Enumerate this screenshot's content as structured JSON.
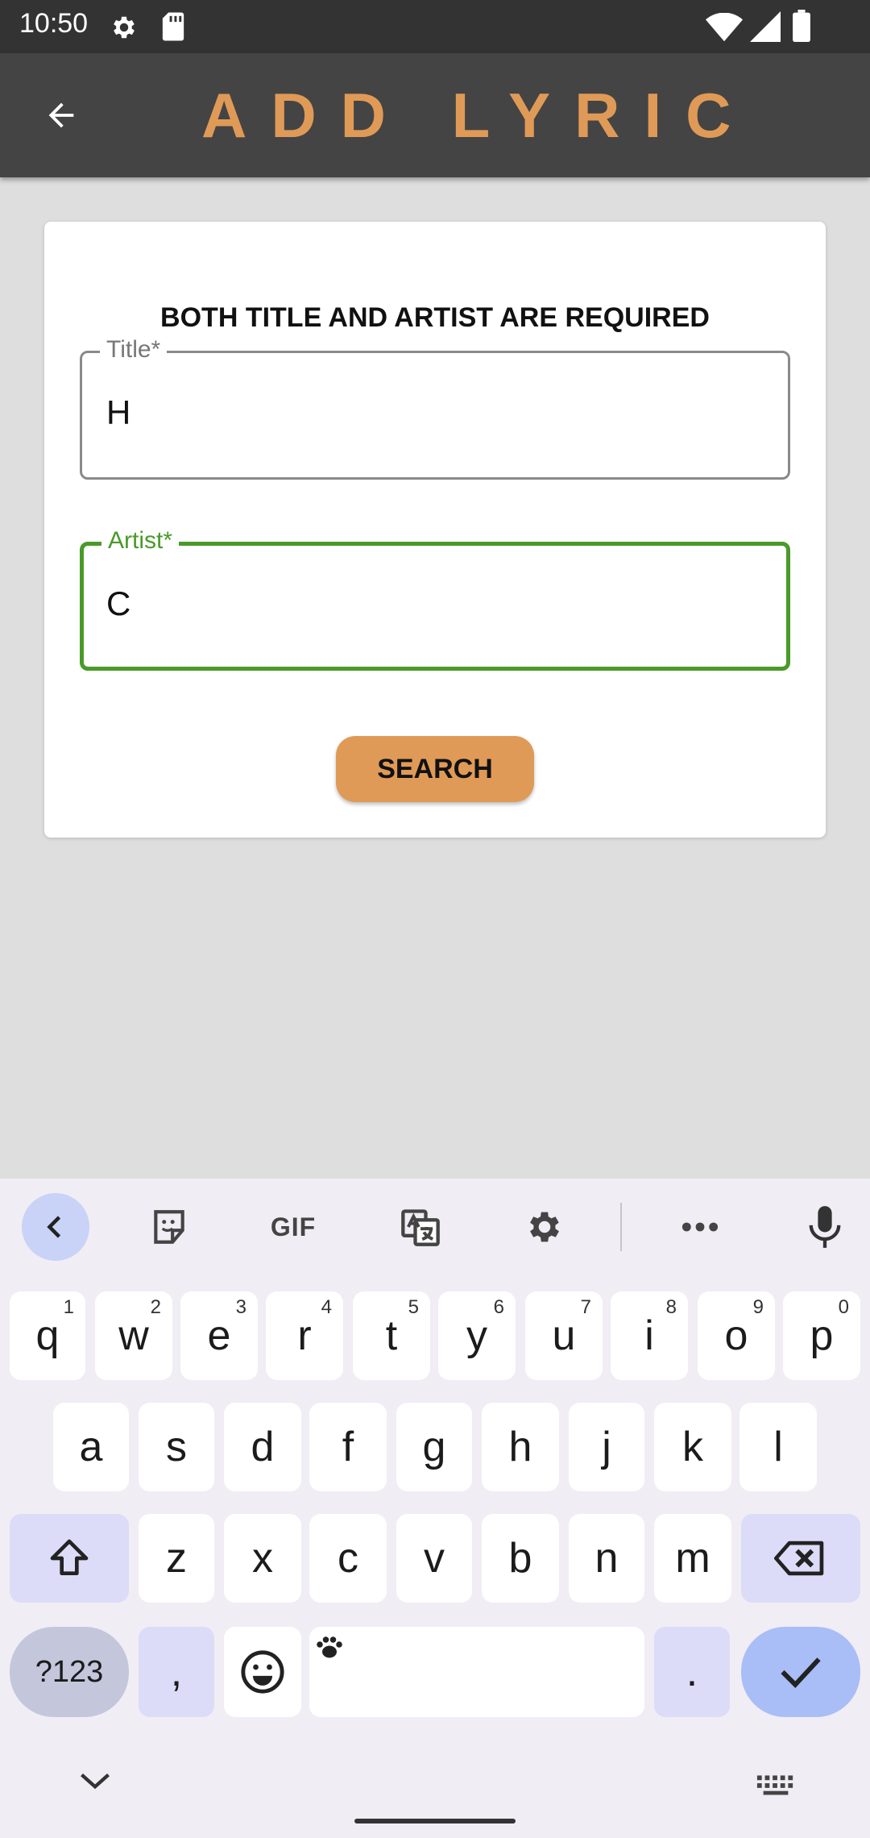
{
  "status_bar": {
    "time": "10:50",
    "icons": [
      "gear-icon",
      "sd-card-icon",
      "wifi-icon",
      "signal-icon",
      "battery-icon"
    ]
  },
  "app_bar": {
    "title": "ADD LYRIC",
    "back_icon": "arrow-back-icon",
    "title_color": "#e09a57"
  },
  "form": {
    "heading": "BOTH TITLE AND ARTIST ARE REQUIRED",
    "title_field": {
      "label": "Title*",
      "value": "H"
    },
    "artist_field": {
      "label": "Artist*",
      "value": "C",
      "focused": true,
      "focus_color": "#4a9a29"
    },
    "search_button": "SEARCH",
    "button_color": "#e09a57"
  },
  "keyboard": {
    "toolbar": [
      "chevron-left-icon",
      "sticker-icon",
      "GIF",
      "translate-icon",
      "settings-icon",
      "more-icon",
      "mic-icon"
    ],
    "gif_label": "GIF",
    "row1": [
      {
        "key": "q",
        "hint": "1"
      },
      {
        "key": "w",
        "hint": "2"
      },
      {
        "key": "e",
        "hint": "3"
      },
      {
        "key": "r",
        "hint": "4"
      },
      {
        "key": "t",
        "hint": "5"
      },
      {
        "key": "y",
        "hint": "6"
      },
      {
        "key": "u",
        "hint": "7"
      },
      {
        "key": "i",
        "hint": "8"
      },
      {
        "key": "o",
        "hint": "9"
      },
      {
        "key": "p",
        "hint": "0"
      }
    ],
    "row2": [
      "a",
      "s",
      "d",
      "f",
      "g",
      "h",
      "j",
      "k",
      "l"
    ],
    "row3": [
      "z",
      "x",
      "c",
      "v",
      "b",
      "n",
      "m"
    ],
    "symbols_key": "?123",
    "comma_key": ",",
    "period_key": "."
  }
}
